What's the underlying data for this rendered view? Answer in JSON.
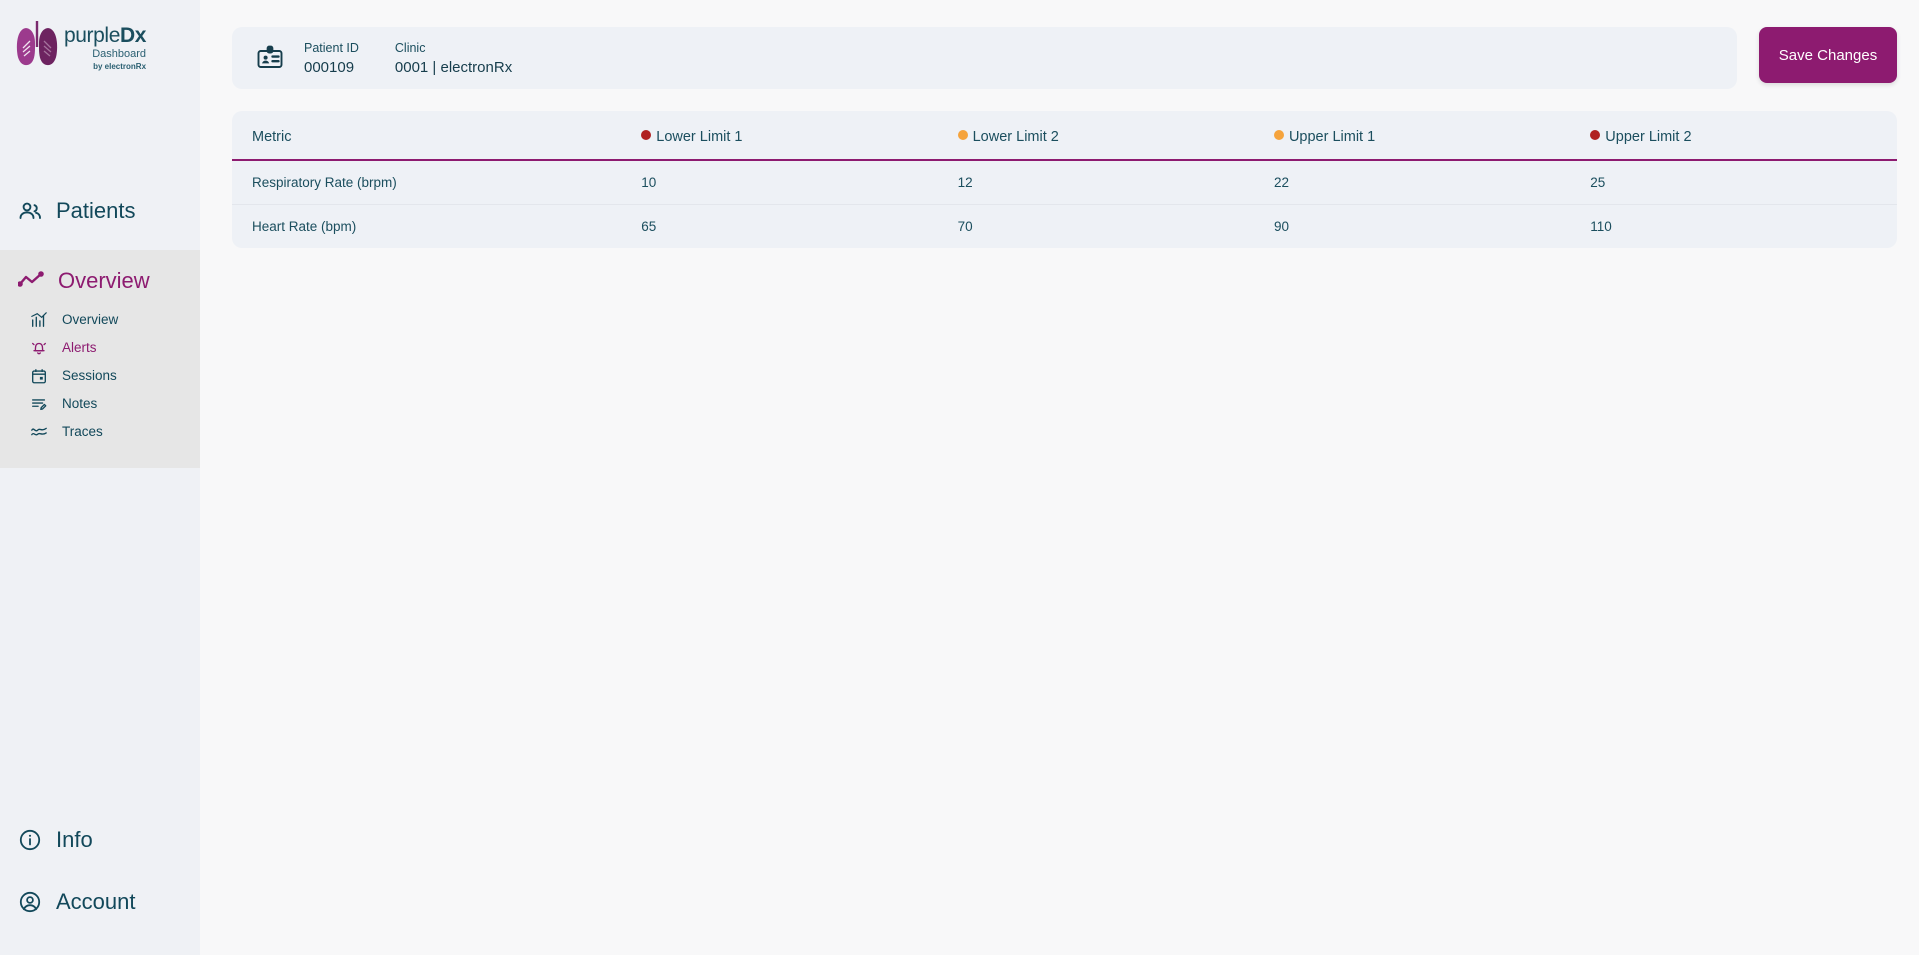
{
  "brand": {
    "title_light": "purple",
    "title_bold": "Dx",
    "subtitle": "Dashboard",
    "byline": "by electronRx",
    "logo_icon": "lungs-icon"
  },
  "sidebar": {
    "patients": {
      "label": "Patients",
      "icon": "users-icon"
    },
    "section": {
      "label": "Overview",
      "icon": "trend-line-icon",
      "items": [
        {
          "label": "Overview",
          "icon": "bar-chart-icon",
          "active": false
        },
        {
          "label": "Alerts",
          "icon": "bell-alert-icon",
          "active": true
        },
        {
          "label": "Sessions",
          "icon": "calendar-icon",
          "active": false
        },
        {
          "label": "Notes",
          "icon": "notes-edit-icon",
          "active": false
        },
        {
          "label": "Traces",
          "icon": "waveform-icon",
          "active": false
        }
      ]
    },
    "bottom": [
      {
        "label": "Info",
        "icon": "info-circle-icon"
      },
      {
        "label": "Account",
        "icon": "account-circle-icon"
      }
    ]
  },
  "patient_card": {
    "icon": "id-badge-icon",
    "fields": [
      {
        "label": "Patient ID",
        "value": "000109"
      },
      {
        "label": "Clinic",
        "value": "0001 | electronRx"
      }
    ]
  },
  "toolbar": {
    "save_label": "Save Changes"
  },
  "limits_table": {
    "columns": [
      {
        "label": "Metric",
        "dot": null
      },
      {
        "label": "Lower Limit 1",
        "dot": "#b02020"
      },
      {
        "label": "Lower Limit 2",
        "dot": "#f5a33c"
      },
      {
        "label": "Upper Limit 1",
        "dot": "#f5a33c"
      },
      {
        "label": "Upper Limit 2",
        "dot": "#b02020"
      }
    ],
    "rows": [
      {
        "metric": "Respiratory Rate (brpm)",
        "lower1": "10",
        "lower2": "12",
        "upper1": "22",
        "upper2": "25"
      },
      {
        "metric": "Heart Rate (bpm)",
        "lower1": "65",
        "lower2": "70",
        "upper1": "90",
        "upper2": "110"
      }
    ]
  },
  "colors": {
    "accent_purple": "#8d1b70",
    "teal": "#12485a",
    "sidebar_bg": "#eff1f5",
    "active_bg": "#e6e6e6",
    "card_bg": "#eef1f6",
    "page_bg": "#f8f8f9",
    "dot_red": "#b02020",
    "dot_orange": "#f5a33c"
  }
}
